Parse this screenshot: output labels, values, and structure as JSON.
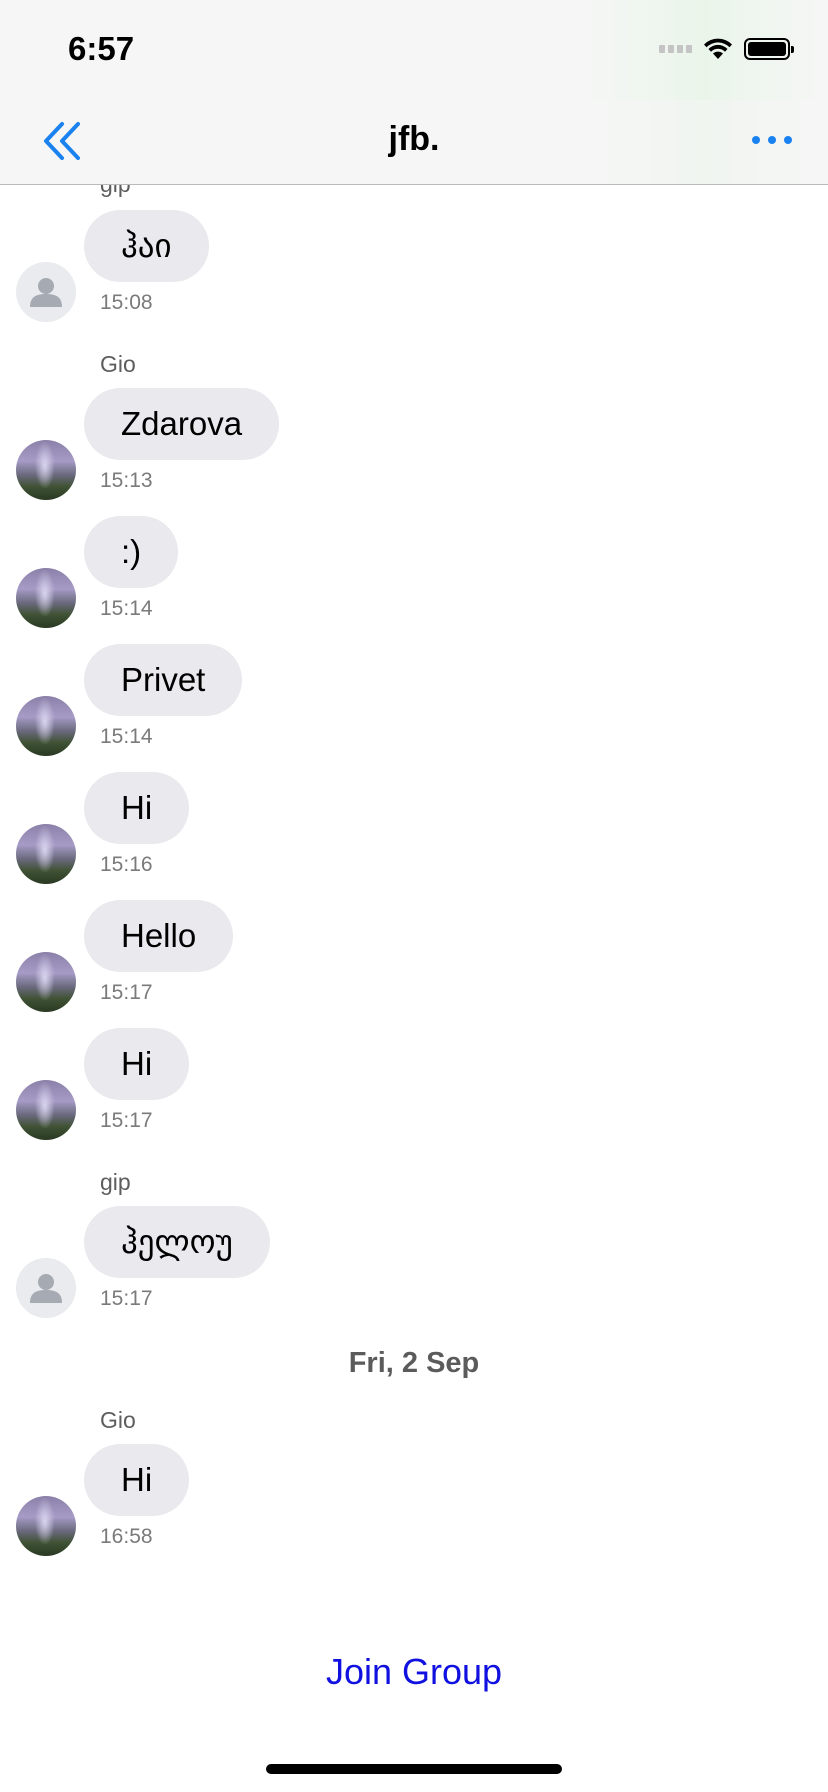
{
  "status_bar": {
    "time": "6:57"
  },
  "header": {
    "title": "jfb."
  },
  "messages": [
    {
      "sender": "gip",
      "text": "ჰაი",
      "time": "15:08",
      "avatar": "person-placeholder"
    },
    {
      "sender": "Gio",
      "text": "Zdarova",
      "time": "15:13",
      "avatar": "waterfall-photo"
    },
    {
      "text": ":)",
      "time": "15:14",
      "avatar": "waterfall-photo"
    },
    {
      "text": "Privet",
      "time": "15:14",
      "avatar": "waterfall-photo"
    },
    {
      "text": "Hi",
      "time": "15:16",
      "avatar": "waterfall-photo"
    },
    {
      "text": "Hello",
      "time": "15:17",
      "avatar": "waterfall-photo"
    },
    {
      "text": "Hi",
      "time": "15:17",
      "avatar": "waterfall-photo"
    },
    {
      "sender": "gip",
      "text": "ჰელოუ",
      "time": "15:17",
      "avatar": "person-placeholder"
    },
    {
      "date_separator": "Fri, 2 Sep"
    },
    {
      "sender": "Gio",
      "text": "Hi",
      "time": "16:58",
      "avatar": "waterfall-photo"
    }
  ],
  "footer": {
    "join_label": "Join Group"
  },
  "colors": {
    "accent": "#1a82f0",
    "join": "#1010e0",
    "bubble": "#e9e9ee"
  }
}
